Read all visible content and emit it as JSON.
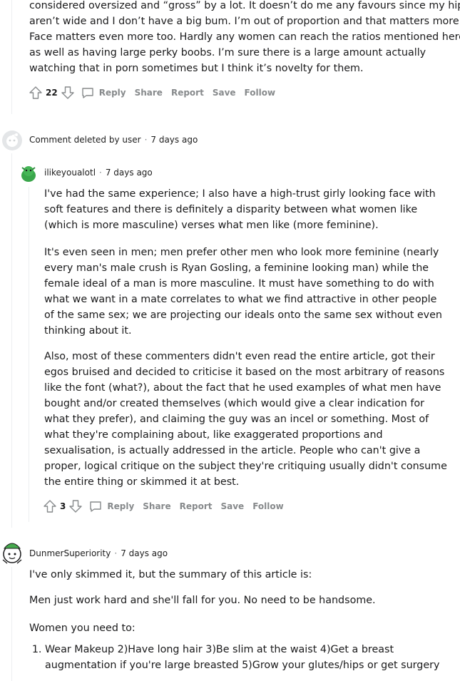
{
  "top_comment": {
    "lines": [
      "considered oversized and “gross” by a lot. It doesn’t do me any favours since my hips",
      "aren’t wide and I don’t have a big bum. I’m out of proportion and that matters more.",
      "Face matters even more too. Hardly any women can reach the ratios mentioned here",
      "as well as having large perky boobs. I’m sure there is a large amount actually",
      "watching that in porn sometimes but I think it’s novelty for them."
    ],
    "score": "22"
  },
  "actions": {
    "reply": "Reply",
    "share": "Share",
    "report": "Report",
    "save": "Save",
    "follow": "Follow"
  },
  "deleted_comment": {
    "label": "Comment deleted by user",
    "time": "7 days ago"
  },
  "reply1": {
    "username": "ilikeyoualotl",
    "time": "7 days ago",
    "paragraphs": [
      "I've had the same experience; I also have a high-trust girly looking face with soft features and there is definitely a disparity between what women like (which is more masculine) verses what men like (more feminine).",
      "It's even seen in men; men prefer other men who look more feminine (nearly every man's male crush is Ryan Gosling, a feminine looking man) while the female ideal of a man is more masculine. It must have something to do with what we want in a mate correlates to what we find attractive in other people of the same sex; we are projecting our ideals onto the same sex without even thinking about it.",
      "Also, most of these commenters didn't even read the entire article, got their egos bruised and decided to criticise it based on the most arbitrary of reasons like the font (what?), about the fact that he used examples of what men have bought and/or created themselves (which would give a clear indication for what they prefer), and claiming the guy was an incel or something. Most of what they're complaining about, like exaggerated proportions and sexualisation, is actually addressed in the article. People who can't give a proper, logical critique on the subject they're critiquing usually didn't consume the entire thing or skimmed it at best."
    ],
    "score": "3"
  },
  "reply2": {
    "username": "DunmerSuperiority",
    "time": "7 days ago",
    "paragraphs": [
      "I've only skimmed it, but the summary of this article is:",
      "Men just work hard and she'll fall for you. No need to be handsome.",
      "Women you need to:"
    ],
    "list_item": "Wear Makeup 2)Have long hair 3)Be slim at the waist 4)Get a breast augmentation if you're large breasted 5)Grow your glutes/hips or get surgery"
  },
  "colors": {
    "text": "#1a1a1b",
    "muted": "#878a8c",
    "thread": "#edeff1"
  }
}
